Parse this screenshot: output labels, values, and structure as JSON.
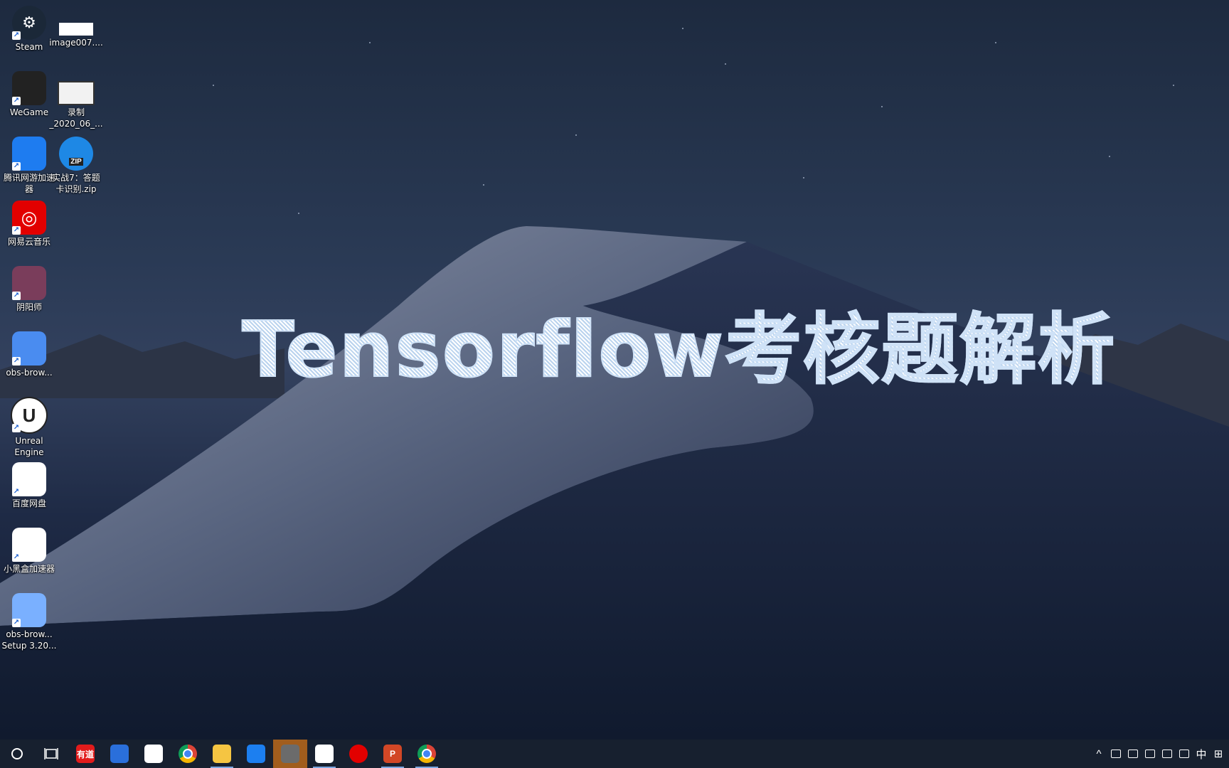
{
  "desktop_icons": [
    {
      "id": "steam",
      "label": "Steam",
      "icon": "steam-icon",
      "color": "#1b2838"
    },
    {
      "id": "image007",
      "label": "image007....",
      "icon": "image-file-icon",
      "color": "#ffffff"
    },
    {
      "id": "wegame",
      "label": "WeGame",
      "icon": "wegame-icon",
      "color": "#222222"
    },
    {
      "id": "recording",
      "label": "录制\n_2020_06_...",
      "icon": "video-file-icon",
      "color": "#f2f2f2"
    },
    {
      "id": "tencent-accel",
      "label": "腾讯网游加速\n器",
      "icon": "tencent-accelerator-icon",
      "color": "#1e7cf0"
    },
    {
      "id": "zip",
      "label": "实战7：答题\n卡识别.zip",
      "icon": "zip-archive-icon",
      "color": "#1e88e5"
    },
    {
      "id": "netease-music",
      "label": "网易云音乐",
      "icon": "netease-music-icon",
      "color": "#e20000"
    },
    {
      "id": "onmyoji",
      "label": "阴阳师",
      "icon": "onmyoji-icon",
      "color": "#7a3d5b"
    },
    {
      "id": "obs-browser",
      "label": "obs-brow...",
      "icon": "cloud-upload-icon",
      "color": "#4a8cf0"
    },
    {
      "id": "unreal",
      "label": "Unreal\nEngine",
      "icon": "unreal-engine-icon",
      "color": "#ffffff"
    },
    {
      "id": "baidu-pan",
      "label": "百度网盘",
      "icon": "baidu-netdisk-icon",
      "color": "#ffffff"
    },
    {
      "id": "xiaoheihe",
      "label": "小黑盒加速器",
      "icon": "xiaoheihe-accelerator-icon",
      "color": "#ffffff"
    },
    {
      "id": "obs-setup",
      "label": "obs-brow...\nSetup 3.20...",
      "icon": "installer-box-icon",
      "color": "#7ab0ff"
    }
  ],
  "overlay_title": "Tensorflow考核题解析",
  "taskbar": {
    "left_buttons": [
      {
        "id": "search",
        "icon": "search-circle-icon"
      },
      {
        "id": "task-view",
        "icon": "task-view-icon"
      }
    ],
    "apps": [
      {
        "id": "youdao",
        "icon": "youdao-dictionary-icon",
        "text": "有道",
        "color": "#e21b1b",
        "state": "normal"
      },
      {
        "id": "docker",
        "icon": "docker-icon",
        "text": "",
        "color": "#2a6fdb",
        "state": "normal"
      },
      {
        "id": "slides-app",
        "icon": "presentation-app-icon",
        "text": "",
        "color": "#ffffff",
        "state": "normal"
      },
      {
        "id": "chrome-1",
        "icon": "chrome-icon",
        "text": "",
        "color": "#ffffff",
        "state": "normal"
      },
      {
        "id": "explorer",
        "icon": "file-explorer-icon",
        "text": "",
        "color": "#f5c542",
        "state": "running"
      },
      {
        "id": "blue-star",
        "icon": "star-app-icon",
        "text": "",
        "color": "#1c7ff0",
        "state": "normal"
      },
      {
        "id": "webcam-app",
        "icon": "webcam-app-icon",
        "text": "",
        "color": "#6b6b6b",
        "state": "active"
      },
      {
        "id": "baidu-pan-tb",
        "icon": "baidu-netdisk-icon",
        "text": "",
        "color": "#ffffff",
        "state": "running"
      },
      {
        "id": "netease-tb",
        "icon": "netease-music-icon",
        "text": "",
        "color": "#e20000",
        "state": "normal"
      },
      {
        "id": "powerpoint",
        "icon": "powerpoint-icon",
        "text": "P",
        "color": "#d24726",
        "state": "running"
      },
      {
        "id": "chrome-2",
        "icon": "chrome-icon",
        "text": "",
        "color": "#ffffff",
        "state": "running"
      }
    ],
    "tray": [
      {
        "id": "chevron",
        "icon": "chevron-up-icon",
        "text": "^"
      },
      {
        "id": "shield",
        "icon": "security-shield-icon",
        "text": ""
      },
      {
        "id": "onedrive",
        "icon": "cloud-icon",
        "text": ""
      },
      {
        "id": "battery",
        "icon": "battery-icon",
        "text": ""
      },
      {
        "id": "volume",
        "icon": "volume-icon",
        "text": ""
      },
      {
        "id": "network",
        "icon": "network-icon",
        "text": ""
      },
      {
        "id": "ime-lang",
        "icon": "ime-language",
        "text": "中"
      },
      {
        "id": "ime-grid",
        "icon": "ime-grid-icon",
        "text": "⊞"
      }
    ]
  }
}
